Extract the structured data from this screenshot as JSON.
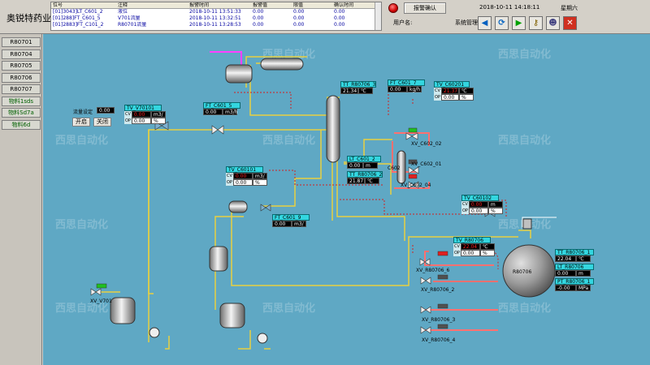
{
  "app": {
    "title": "奥锐特药业"
  },
  "alarms": {
    "headers": [
      "位号",
      "注释",
      "报警时间",
      "报警值",
      "限值",
      "确认时间"
    ],
    "rows": [
      [
        "[01]3043]LT_C601_2",
        "液位",
        "2018-10-11 13:51:33",
        "0.00",
        "0.00",
        "0.00"
      ],
      [
        "[01]288]FT_C601_5",
        "V701流量",
        "2018-10-11 13:32:51",
        "0.00",
        "0.00",
        "0.00"
      ],
      [
        "[01]2883]FT_C101_2",
        "R80701流量",
        "2018-10-11 13:28:53",
        "0.00",
        "0.00",
        "0.00"
      ]
    ]
  },
  "header": {
    "ack_label": "报警确认",
    "datetime": "2018-10-11 14:18:11",
    "weekday": "星期六",
    "user_label": "用户名:",
    "user_name": "系统管理员"
  },
  "toolbar": [
    {
      "name": "arrow-left-icon",
      "glyph": "◀",
      "color": "#0060c0"
    },
    {
      "name": "refresh-icon",
      "glyph": "⟳",
      "color": "#0060c0"
    },
    {
      "name": "arrow-right-icon",
      "glyph": "▶",
      "color": "#00a000"
    },
    {
      "name": "key-icon",
      "glyph": "⚷",
      "color": "#806000"
    },
    {
      "name": "user-icon",
      "glyph": "☻",
      "color": "#404080"
    },
    {
      "name": "close-icon",
      "glyph": "✕",
      "color": "#ffffff"
    }
  ],
  "sidebar": {
    "items": [
      "R80701",
      "R80704",
      "R80705",
      "R80706",
      "R80707",
      "物料1sds",
      "物料Sd7a",
      "物料6d"
    ]
  },
  "watermark": "西思自动化",
  "flow_control": {
    "label": "流量设定",
    "value": "0.00",
    "open_label": "开启",
    "close_label": "关闭"
  },
  "instruments": [
    {
      "id": "TV_V70101",
      "rows": [
        [
          "CV",
          "0.00",
          "m3/"
        ],
        [
          "OP",
          "0.00",
          "%"
        ]
      ]
    },
    {
      "id": "FT_C601_5",
      "rows": [
        [
          "",
          "0.00",
          "m3/h"
        ]
      ]
    },
    {
      "id": "TV_C60101",
      "rows": [
        [
          "CV",
          "0.00",
          "m3/"
        ],
        [
          "OP",
          "0.00",
          "%"
        ]
      ]
    },
    {
      "id": "FT_C601_9",
      "rows": [
        [
          "",
          "0.00",
          "m3/"
        ]
      ]
    },
    {
      "id": "TT_R80706_3",
      "rows": [
        [
          "",
          "21.34",
          "℃"
        ]
      ]
    },
    {
      "id": "FT_C601_7",
      "rows": [
        [
          "",
          "0.00",
          "kg/h"
        ]
      ]
    },
    {
      "id": "TV_C60201",
      "rows": [
        [
          "CV",
          "21.37",
          "℃"
        ],
        [
          "OP",
          "0.00",
          "%"
        ]
      ]
    },
    {
      "id": "LT_C601_2",
      "rows": [
        [
          "",
          "0.00",
          "m"
        ]
      ]
    },
    {
      "id": "TT_R80706_2",
      "rows": [
        [
          "",
          "21.87",
          "℃"
        ]
      ]
    },
    {
      "id": "TV_C60102",
      "rows": [
        [
          "CV",
          "0.00",
          "m"
        ],
        [
          "OP",
          "0.00",
          "%"
        ]
      ]
    },
    {
      "id": "TV_R80706",
      "rows": [
        [
          "CV",
          "22.04",
          "℃"
        ],
        [
          "OP",
          "0.00",
          "%"
        ]
      ]
    },
    {
      "id": "TT_R80706_1",
      "rows": [
        [
          "",
          "22.04",
          "℃"
        ]
      ]
    },
    {
      "id": "LT_R80706",
      "rows": [
        [
          "",
          "0.00",
          "m"
        ]
      ]
    },
    {
      "id": "PT_R80706_1",
      "rows": [
        [
          "",
          "-0.00",
          "MPa"
        ]
      ]
    }
  ],
  "equipment_labels": {
    "reactor": "R80706",
    "column": "C602",
    "xv_c602_2": "XV_C602_02",
    "xv_c602_1": "XV_C602_01",
    "xv_c602_4": "XV_C602_04",
    "xv_v701": "XV_V701",
    "xv_r6": "XV_R80706_6",
    "xv_r2": "XV_R80706_2",
    "xv_r3": "XV_R80706_3",
    "xv_r4": "XV_R80706_4"
  },
  "colors": {
    "canvas": "#5fa8c4",
    "tag": "#33d6e0",
    "pipe": "#e8d040",
    "steam": "#ff40ff",
    "hot": "#ff7070"
  }
}
